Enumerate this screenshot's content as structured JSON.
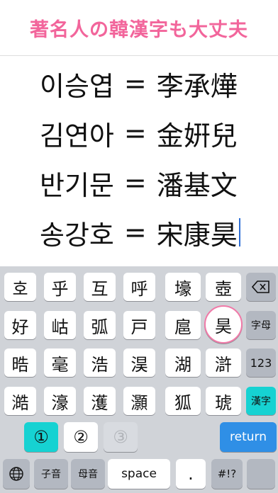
{
  "header": {
    "title": "著名人の韓漢字も大丈夫"
  },
  "entries": [
    {
      "hangul": "이승엽",
      "equals": "=",
      "hanja": "李承燁"
    },
    {
      "hangul": "김연아",
      "equals": "=",
      "hanja": "金姸兒"
    },
    {
      "hangul": "반기문",
      "equals": "=",
      "hanja": "潘基文"
    },
    {
      "hangul": "송강호",
      "equals": "=",
      "hanja": "宋康昊"
    }
  ],
  "keyboard": {
    "rows": [
      [
        "호",
        "乎",
        "互",
        "呼",
        "壕",
        "壺"
      ],
      [
        "好",
        "岵",
        "弧",
        "戸",
        "扈",
        "昊"
      ],
      [
        "晧",
        "毫",
        "浩",
        "淏",
        "湖",
        "滸"
      ],
      [
        "澔",
        "濠",
        "濩",
        "灝",
        "狐",
        "琥"
      ]
    ],
    "side": {
      "delete_icon": "backspace-icon",
      "jamo_label": "字母",
      "num_label": "123",
      "hanja_label": "漢字"
    },
    "candidates": [
      "①",
      "②",
      "③"
    ],
    "return_label": "return",
    "bottom": {
      "globe_icon": "globe-icon",
      "consonant_label": "子音",
      "vowel_label": "母音",
      "space_label": "space",
      "period_label": ".",
      "symbols_label": "#!?"
    },
    "colors": {
      "accent_cyan": "#16d2d2",
      "return_blue": "#2f8fe6",
      "highlight_pink": "#f07aa8"
    }
  }
}
